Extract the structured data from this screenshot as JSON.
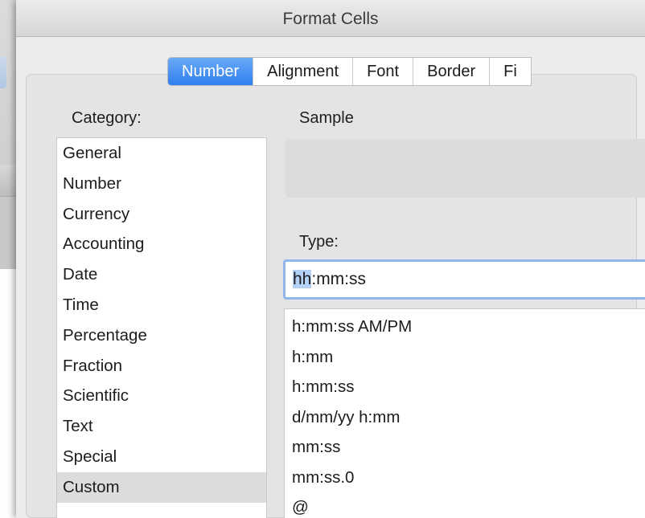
{
  "dialog": {
    "title": "Format Cells"
  },
  "tabs": [
    {
      "label": "Number",
      "active": true
    },
    {
      "label": "Alignment",
      "active": false
    },
    {
      "label": "Font",
      "active": false
    },
    {
      "label": "Border",
      "active": false
    },
    {
      "label": "Fi",
      "active": false
    }
  ],
  "category": {
    "label": "Category:",
    "items": [
      "General",
      "Number",
      "Currency",
      "Accounting",
      "Date",
      "Time",
      "Percentage",
      "Fraction",
      "Scientific",
      "Text",
      "Special",
      "Custom"
    ],
    "selected": "Custom"
  },
  "sample": {
    "label": "Sample",
    "value": ""
  },
  "type": {
    "label": "Type:",
    "value_selected": "hh",
    "value_rest": ":mm:ss",
    "formats": [
      "h:mm:ss AM/PM",
      "h:mm",
      "h:mm:ss",
      "d/mm/yy h:mm",
      "mm:ss",
      "mm:ss.0",
      "@"
    ]
  },
  "colors": {
    "accent": "#2e7ff0",
    "selection": "#b4d2f7",
    "focus_ring": "#8fb6ea"
  }
}
